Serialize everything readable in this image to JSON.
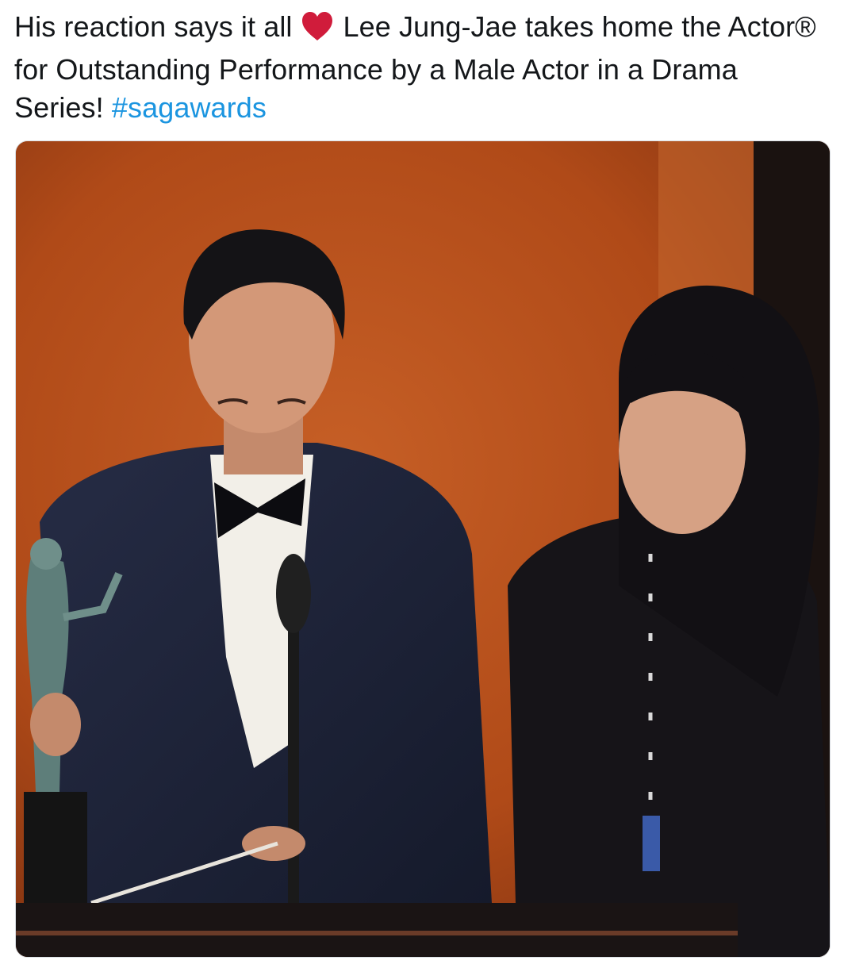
{
  "tweet": {
    "text_before_emoji": "His reaction says it all",
    "emoji": "heart-emoji",
    "text_after_emoji": "Lee Jung-Jae takes home the Actor® for Outstanding Performance by a Male Actor in a Drama Series!",
    "hashtag": "#sagawards"
  },
  "media": {
    "type": "video-still"
  },
  "colors": {
    "text": "#14171a",
    "link": "#1b95e0",
    "heart": "#d01c3b",
    "backdrop": "#b8521c",
    "suit": "#1c2135"
  }
}
